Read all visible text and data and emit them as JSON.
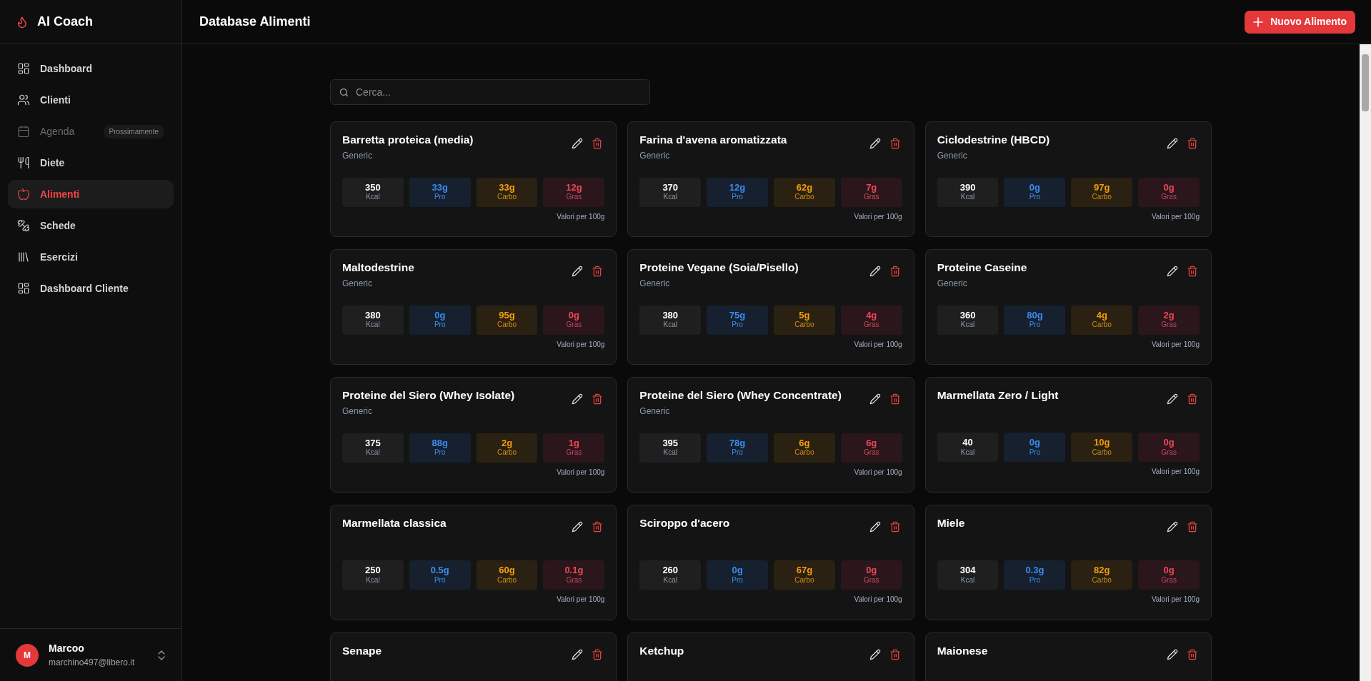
{
  "brand": {
    "name": "AI Coach"
  },
  "sidebar": {
    "items": [
      {
        "kind": "grid",
        "label": "Dashboard",
        "selected": false,
        "disabled": false
      },
      {
        "kind": "users",
        "label": "Clienti",
        "selected": false,
        "disabled": false
      },
      {
        "kind": "calendar",
        "label": "Agenda",
        "selected": false,
        "disabled": true,
        "badge": "Prossimamente"
      },
      {
        "kind": "utensils",
        "label": "Diete",
        "selected": false,
        "disabled": false
      },
      {
        "kind": "apple",
        "label": "Alimenti",
        "selected": true,
        "disabled": false
      },
      {
        "kind": "dumbbell",
        "label": "Schede",
        "selected": false,
        "disabled": false
      },
      {
        "kind": "library",
        "label": "Esercizi",
        "selected": false,
        "disabled": false
      },
      {
        "kind": "grid",
        "label": "Dashboard Cliente",
        "selected": false,
        "disabled": false
      }
    ]
  },
  "user": {
    "initial": "M",
    "name": "Marcoo",
    "email": "marchino497@libero.it"
  },
  "header": {
    "title": "Database Alimenti",
    "button": "Nuovo Alimento"
  },
  "search": {
    "placeholder": "Cerca..."
  },
  "foods": [
    {
      "name": "Barretta proteica (media)",
      "category": "Generic",
      "note": "Valori per 100g",
      "macros": [
        {
          "kind": "kcal",
          "value": "350",
          "label": "Kcal"
        },
        {
          "kind": "pro",
          "value": "33g",
          "label": "Pro"
        },
        {
          "kind": "carbo",
          "value": "33g",
          "label": "Carbo"
        },
        {
          "kind": "gras",
          "value": "12g",
          "label": "Gras"
        }
      ]
    },
    {
      "name": "Farina d'avena aromatizzata",
      "category": "Generic",
      "note": "Valori per 100g",
      "macros": [
        {
          "kind": "kcal",
          "value": "370",
          "label": "Kcal"
        },
        {
          "kind": "pro",
          "value": "12g",
          "label": "Pro"
        },
        {
          "kind": "carbo",
          "value": "62g",
          "label": "Carbo"
        },
        {
          "kind": "gras",
          "value": "7g",
          "label": "Gras"
        }
      ]
    },
    {
      "name": "Ciclodestrine (HBCD)",
      "category": "Generic",
      "note": "Valori per 100g",
      "macros": [
        {
          "kind": "kcal",
          "value": "390",
          "label": "Kcal"
        },
        {
          "kind": "pro",
          "value": "0g",
          "label": "Pro"
        },
        {
          "kind": "carbo",
          "value": "97g",
          "label": "Carbo"
        },
        {
          "kind": "gras",
          "value": "0g",
          "label": "Gras"
        }
      ]
    },
    {
      "name": "Maltodestrine",
      "category": "Generic",
      "note": "Valori per 100g",
      "macros": [
        {
          "kind": "kcal",
          "value": "380",
          "label": "Kcal"
        },
        {
          "kind": "pro",
          "value": "0g",
          "label": "Pro"
        },
        {
          "kind": "carbo",
          "value": "95g",
          "label": "Carbo"
        },
        {
          "kind": "gras",
          "value": "0g",
          "label": "Gras"
        }
      ]
    },
    {
      "name": "Proteine Vegane (Soia/Pisello)",
      "category": "Generic",
      "note": "Valori per 100g",
      "macros": [
        {
          "kind": "kcal",
          "value": "380",
          "label": "Kcal"
        },
        {
          "kind": "pro",
          "value": "75g",
          "label": "Pro"
        },
        {
          "kind": "carbo",
          "value": "5g",
          "label": "Carbo"
        },
        {
          "kind": "gras",
          "value": "4g",
          "label": "Gras"
        }
      ]
    },
    {
      "name": "Proteine Caseine",
      "category": "Generic",
      "note": "Valori per 100g",
      "macros": [
        {
          "kind": "kcal",
          "value": "360",
          "label": "Kcal"
        },
        {
          "kind": "pro",
          "value": "80g",
          "label": "Pro"
        },
        {
          "kind": "carbo",
          "value": "4g",
          "label": "Carbo"
        },
        {
          "kind": "gras",
          "value": "2g",
          "label": "Gras"
        }
      ]
    },
    {
      "name": "Proteine del Siero (Whey Isolate)",
      "category": "Generic",
      "note": "Valori per 100g",
      "macros": [
        {
          "kind": "kcal",
          "value": "375",
          "label": "Kcal"
        },
        {
          "kind": "pro",
          "value": "88g",
          "label": "Pro"
        },
        {
          "kind": "carbo",
          "value": "2g",
          "label": "Carbo"
        },
        {
          "kind": "gras",
          "value": "1g",
          "label": "Gras"
        }
      ]
    },
    {
      "name": "Proteine del Siero (Whey Concentrate)",
      "category": "Generic",
      "note": "Valori per 100g",
      "macros": [
        {
          "kind": "kcal",
          "value": "395",
          "label": "Kcal"
        },
        {
          "kind": "pro",
          "value": "78g",
          "label": "Pro"
        },
        {
          "kind": "carbo",
          "value": "6g",
          "label": "Carbo"
        },
        {
          "kind": "gras",
          "value": "6g",
          "label": "Gras"
        }
      ]
    },
    {
      "name": "Marmellata Zero / Light",
      "note": "Valori per 100g",
      "macros": [
        {
          "kind": "kcal",
          "value": "40",
          "label": "Kcal"
        },
        {
          "kind": "pro",
          "value": "0g",
          "label": "Pro"
        },
        {
          "kind": "carbo",
          "value": "10g",
          "label": "Carbo"
        },
        {
          "kind": "gras",
          "value": "0g",
          "label": "Gras"
        }
      ]
    },
    {
      "name": "Marmellata classica",
      "note": "Valori per 100g",
      "macros": [
        {
          "kind": "kcal",
          "value": "250",
          "label": "Kcal"
        },
        {
          "kind": "pro",
          "value": "0.5g",
          "label": "Pro"
        },
        {
          "kind": "carbo",
          "value": "60g",
          "label": "Carbo"
        },
        {
          "kind": "gras",
          "value": "0.1g",
          "label": "Gras"
        }
      ]
    },
    {
      "name": "Sciroppo d'acero",
      "note": "Valori per 100g",
      "macros": [
        {
          "kind": "kcal",
          "value": "260",
          "label": "Kcal"
        },
        {
          "kind": "pro",
          "value": "0g",
          "label": "Pro"
        },
        {
          "kind": "carbo",
          "value": "67g",
          "label": "Carbo"
        },
        {
          "kind": "gras",
          "value": "0g",
          "label": "Gras"
        }
      ]
    },
    {
      "name": "Miele",
      "note": "Valori per 100g",
      "macros": [
        {
          "kind": "kcal",
          "value": "304",
          "label": "Kcal"
        },
        {
          "kind": "pro",
          "value": "0.3g",
          "label": "Pro"
        },
        {
          "kind": "carbo",
          "value": "82g",
          "label": "Carbo"
        },
        {
          "kind": "gras",
          "value": "0g",
          "label": "Gras"
        }
      ]
    },
    {
      "name": "Senape"
    },
    {
      "name": "Ketchup"
    },
    {
      "name": "Maionese"
    }
  ]
}
